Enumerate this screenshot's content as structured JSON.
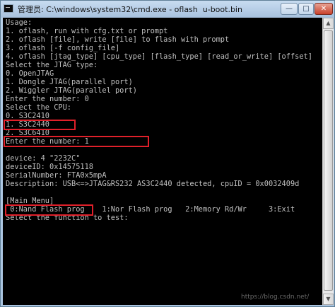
{
  "window": {
    "title": "管理员: C:\\windows\\system32\\cmd.exe - oflash  u-boot.bin",
    "minimize_label": "—",
    "maximize_label": "□",
    "close_label": "✕"
  },
  "console": {
    "lines": [
      "Usage:",
      "1. oflash, run with cfg.txt or prompt",
      "2. oflash [file], write [file] to flash with prompt",
      "3. oflash [-f config_file]",
      "4. oflash [jtag_type] [cpu_type] [flash_type] [read_or_write] [offset]",
      "Select the JTAG type:",
      "0. OpenJTAG",
      "1. Dongle JTAG(parallel port)",
      "2. Wiggler JTAG(parallel port)",
      "Enter the number: 0",
      "Select the CPU:",
      "0. S3C2410",
      "1. S3C2440",
      "2. S3C6410",
      "Enter the number: 1",
      "",
      "device: 4 \"2232C\"",
      "deviceID: 0x14575118",
      "SerialNumber: FTA0x5mpA",
      "Description: USB<=>JTAG&RS232 AS3C2440 detected, cpuID = 0x0032409d",
      "",
      "[Main Menu]",
      " 0:Nand Flash prog    1:Nor Flash prog   2:Memory Rd/Wr     3:Exit",
      "Select the function to test:"
    ]
  },
  "scrollbar": {
    "up_arrow": "▲",
    "down_arrow": "▼"
  },
  "watermark": "https://blog.csdn.net/"
}
